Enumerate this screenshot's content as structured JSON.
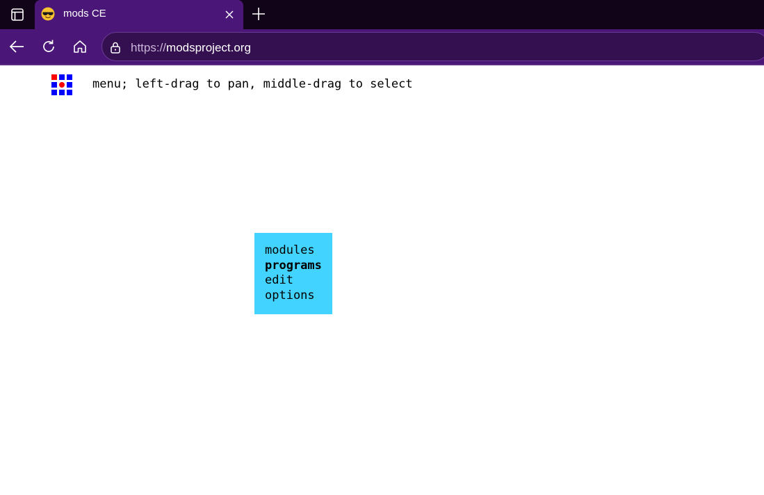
{
  "browser": {
    "tab": {
      "title": "mods CE",
      "favicon": "sunglasses-emoji-icon"
    },
    "address": {
      "scheme": "https://",
      "host": "modsproject.org"
    },
    "icons": {
      "tab_actions": "tab-actions-icon",
      "close": "close-icon",
      "new_tab": "plus-icon",
      "back": "back-arrow-icon",
      "reload": "reload-icon",
      "home": "home-icon",
      "lock": "lock-icon"
    },
    "colors": {
      "tabstrip": "#120418",
      "toolbar": "#4a1677",
      "addressbar": "#351050"
    }
  },
  "page": {
    "logo": "mods-logo-icon",
    "instructions": "menu; left-drag to pan, middle-drag to select",
    "menu": {
      "background": "#42d3ff",
      "items": [
        {
          "label": "modules",
          "bold": false
        },
        {
          "label": "programs",
          "bold": true
        },
        {
          "label": "edit",
          "bold": false
        },
        {
          "label": "options",
          "bold": false
        }
      ]
    }
  }
}
